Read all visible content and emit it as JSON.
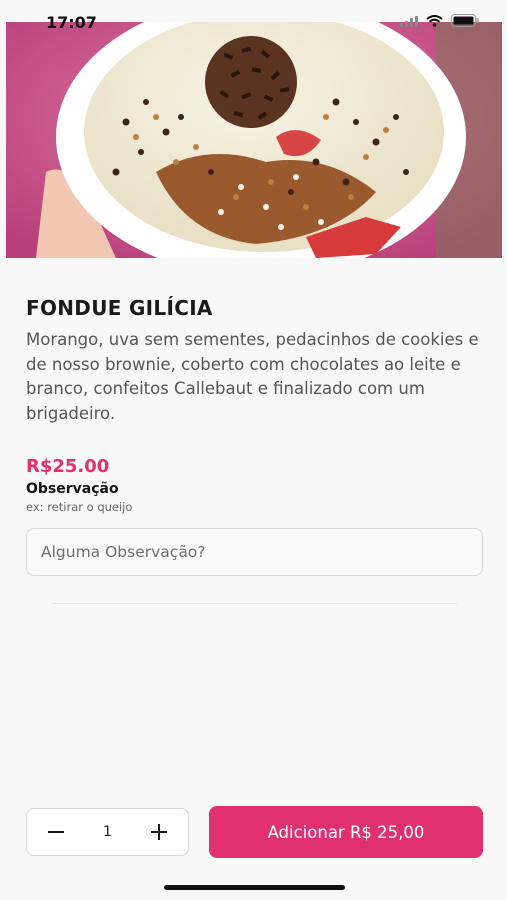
{
  "status_bar": {
    "time": "17:07"
  },
  "product": {
    "name": "FONDUE GILÍCIA",
    "description": "Morango, uva sem sementes, pedacinhos de cookies e de nosso brownie, coberto com chocolates ao leite e branco, confeitos Callebaut e finalizado com um brigadeiro.",
    "price": "R$25.00"
  },
  "observation": {
    "title": "Observação",
    "hint": "ex: retirar o queijo",
    "placeholder": "Alguma Observação?",
    "value": ""
  },
  "cart": {
    "quantity": "1",
    "add_label": "Adicionar R$ 25,00"
  },
  "colors": {
    "accent": "#e0306f"
  },
  "icons": [
    "signal-icon",
    "wifi-icon",
    "battery-icon",
    "minus-icon",
    "plus-icon"
  ]
}
